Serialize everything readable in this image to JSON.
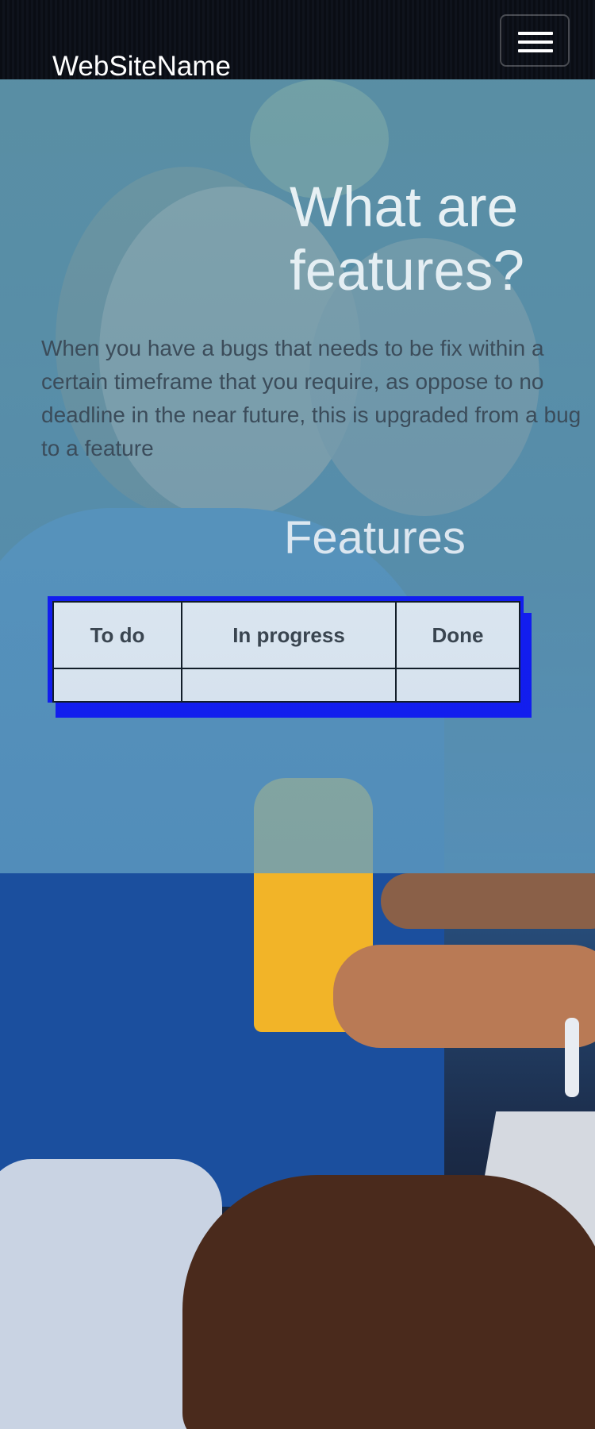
{
  "navbar": {
    "brand": "WebSiteName",
    "toggle_icon": "hamburger-menu-icon"
  },
  "hero": {
    "title": "What are features?",
    "description": "When you have a bugs that needs to be fix within a certain timeframe that you require, as oppose to no deadline in the near future, this is upgraded from a bug to a feature"
  },
  "features": {
    "title": "Features",
    "columns": [
      "To do",
      "In progress",
      "Done"
    ],
    "rows": [
      [
        "",
        "",
        ""
      ]
    ]
  },
  "colors": {
    "overlay": "#6eafc8",
    "board_border": "#0000ff",
    "heading_text": "#ffffff",
    "body_text": "#333b44"
  }
}
